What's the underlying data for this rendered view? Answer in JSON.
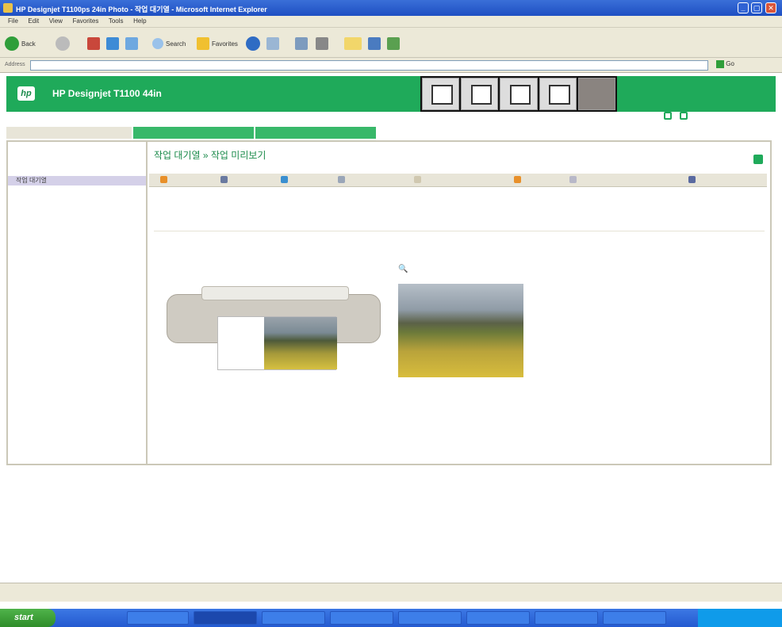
{
  "window": {
    "title": "HP Designjet T1100ps 24in Photo - 작업 대기열 - Microsoft Internet Explorer"
  },
  "menu": [
    "File",
    "Edit",
    "View",
    "Favorites",
    "Tools",
    "Help"
  ],
  "toolbar": {
    "back": "Back",
    "search": "Search",
    "favorites": "Favorites"
  },
  "address": {
    "label": "Address",
    "url": "",
    "go": "Go"
  },
  "page": {
    "product": "HP Designjet T1100 44in",
    "host": "",
    "top_links": [
      "",
      ""
    ],
    "tabs": [
      "",
      "",
      ""
    ],
    "sidebar": [
      {
        "label": "",
        "head": true
      },
      {
        "label": ""
      },
      {
        "label": "",
        "head": true
      },
      {
        "label": "작업 대기열",
        "selected": true
      },
      {
        "label": ""
      },
      {
        "label": ""
      },
      {
        "label": "",
        "head": true
      },
      {
        "label": ""
      },
      {
        "label": ""
      },
      {
        "label": "",
        "head": true
      },
      {
        "label": ""
      }
    ],
    "main_title": "작업 대기열 » 작업 미리보기",
    "actions": [
      "",
      "",
      "",
      "",
      "",
      "",
      "",
      ""
    ],
    "info": [
      {
        "key": "",
        "value": ""
      },
      {
        "key": "",
        "value": ""
      },
      {
        "key": "",
        "value": ""
      }
    ],
    "preview_title_left": "",
    "preview_title_right": ""
  },
  "status": {
    "text": "",
    "zone": ""
  },
  "taskbar": {
    "start": "start",
    "tasks": [
      "",
      "",
      "",
      "",
      "",
      "",
      "",
      ""
    ],
    "clock": ""
  }
}
